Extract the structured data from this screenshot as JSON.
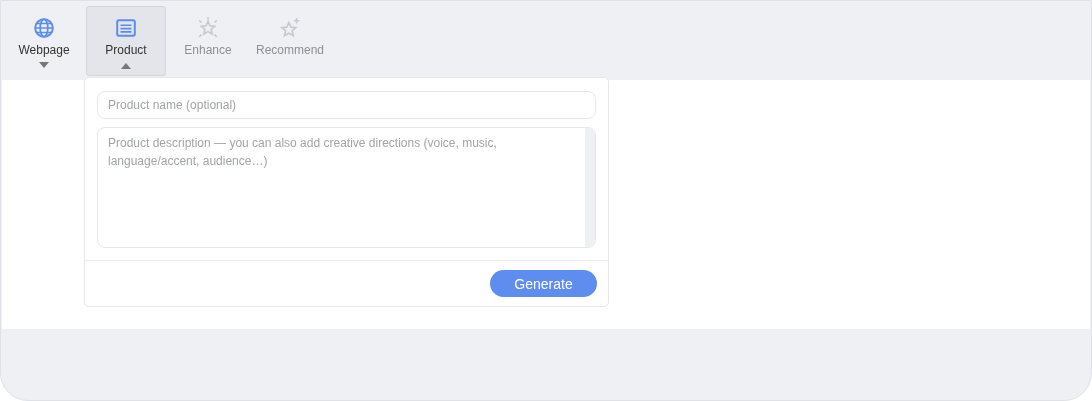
{
  "tabs": [
    {
      "label": "Webpage",
      "selected": false,
      "disabled": false,
      "expanded": false
    },
    {
      "label": "Product",
      "selected": true,
      "disabled": false,
      "expanded": true
    },
    {
      "label": "Enhance",
      "selected": false,
      "disabled": true
    },
    {
      "label": "Recommend",
      "selected": false,
      "disabled": true
    }
  ],
  "panel": {
    "name_field": {
      "placeholder": "Product name (optional)"
    },
    "description_field": {
      "placeholder": "Product description — you can also add creative directions (voice, music, language/accent, audience…)"
    },
    "button": "Generate"
  }
}
